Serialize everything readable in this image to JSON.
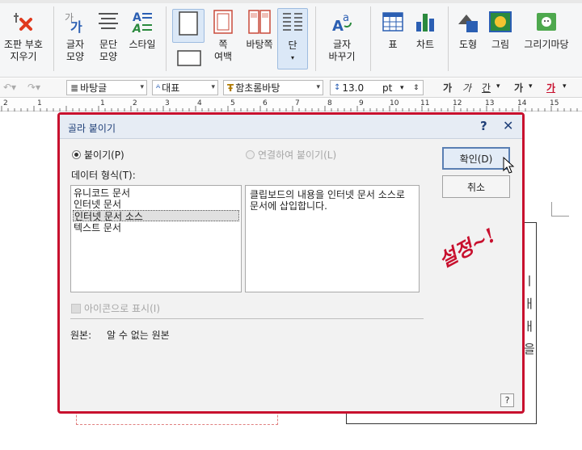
{
  "ribbon": {
    "buttons": [
      {
        "label1": "조판 부호",
        "label2": "지우기",
        "icon": "eraser-x-icon"
      },
      {
        "label1": "글자",
        "label2": "모양",
        "icon": "char-shape-icon"
      },
      {
        "label1": "문단",
        "label2": "모양",
        "icon": "paragraph-shape-icon"
      },
      {
        "label1": "스타일",
        "label2": "",
        "icon": "style-icon"
      },
      {
        "label1": "",
        "label2": "",
        "icon": "page-icon"
      },
      {
        "label1": "쪽",
        "label2": "여백",
        "icon": "page-margin-icon"
      },
      {
        "label1": "바탕쪽",
        "label2": "",
        "icon": "master-page-icon"
      },
      {
        "label1": "단",
        "label2": "",
        "icon": "columns-icon"
      },
      {
        "label1": "글자",
        "label2": "바꾸기",
        "icon": "char-replace-icon"
      },
      {
        "label1": "표",
        "label2": "",
        "icon": "table-icon"
      },
      {
        "label1": "차트",
        "label2": "",
        "icon": "chart-icon"
      },
      {
        "label1": "도형",
        "label2": "",
        "icon": "shape-icon"
      },
      {
        "label1": "그림",
        "label2": "",
        "icon": "picture-icon"
      },
      {
        "label1": "그리기마당",
        "label2": "",
        "icon": "clipart-icon"
      }
    ]
  },
  "format_bar": {
    "style": "바탕글",
    "lang": "대표",
    "font": "함초롬바탕",
    "size": "13.0",
    "unit": "pt",
    "font_buttons": [
      "가",
      "가",
      "간",
      "가",
      "가"
    ]
  },
  "ruler": {
    "numbers": [
      "2",
      "1",
      "1",
      "2",
      "3",
      "4",
      "5",
      "6",
      "7",
      "8",
      "9",
      "10",
      "11",
      "12",
      "13",
      "14",
      "15"
    ]
  },
  "dialog": {
    "title": "골라 붙이기",
    "help": "?",
    "close": "✕",
    "paste_label": "붙이기(P)",
    "link_label": "연결하여 붙이기(L)",
    "data_format_label": "데이터 형식(T):",
    "formats": [
      "유니코드 문서",
      "인터넷 문서",
      "인터넷 문서 소스",
      "텍스트 문서"
    ],
    "selected_format": "인터넷 문서 소스",
    "description": "클립보드의 내용을 인터넷 문서 소스로 문서에 삽입합니다.",
    "ok_label": "확인(D)",
    "cancel_label": "취소",
    "icon_display_label": "아이콘으로 표시(I)",
    "source_label": "원본:",
    "source_value": "알 수 없는 원본",
    "help_small": "?"
  },
  "annotation": {
    "text": "설정~!",
    "color": "#c8102e"
  },
  "document": {
    "chars": [
      "ㅣ",
      "ㅐ",
      "ㅐ",
      "을"
    ]
  }
}
